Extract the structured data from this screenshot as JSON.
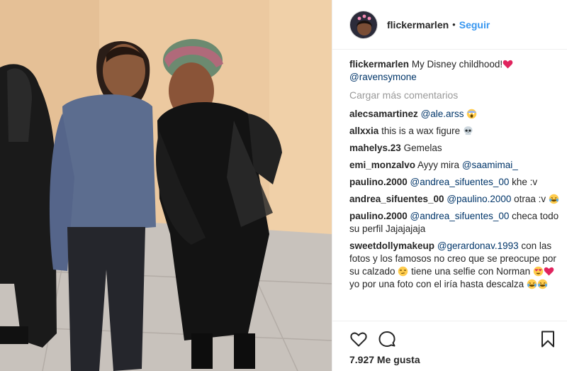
{
  "post": {
    "username": "flickermarlen",
    "separator": "•",
    "follow_label": "Seguir",
    "caption_text": "My Disney childhood!",
    "caption_mention": "@ravensymone",
    "load_more_label": "Cargar más comentarios",
    "likes_label": "7.927 Me gusta"
  },
  "comments": [
    {
      "user": "alecsamartinez",
      "mention": "@ale.arss",
      "text": "",
      "emoji": "scream-emoji"
    },
    {
      "user": "allxxia",
      "text": "this is a wax figure",
      "emoji": "skull-emoji"
    },
    {
      "user": "mahelys.23",
      "text": "Gemelas"
    },
    {
      "user": "emi_monzalvo",
      "text": "Ayyy mira",
      "mention": "@saamimai_"
    },
    {
      "user": "paulino.2000",
      "mention": "@andrea_sifuentes_00",
      "text": "khe :v"
    },
    {
      "user": "andrea_sifuentes_00",
      "mention": "@paulino.2000",
      "text": "otraa :v",
      "emoji": "laughing-tears-emoji"
    },
    {
      "user": "paulino.2000",
      "mention": "@andrea_sifuentes_00",
      "text": "checa todo su perfil Jajajajaja"
    },
    {
      "user": "sweetdollymakeup",
      "mention": "@gerardonav.1993",
      "text": "con las fotos y los famosos no creo que se preocupe por su calzado",
      "text2": "tiene una selfie con Norman",
      "text3": "yo por una foto con el iría hasta descalza"
    }
  ],
  "colors": {
    "link": "#003569",
    "follow": "#3897f0",
    "heart": "#e0245e",
    "muted": "#999999"
  },
  "icons": {
    "like": "heart-outline-icon",
    "comment": "speech-bubble-icon",
    "save": "bookmark-icon"
  }
}
